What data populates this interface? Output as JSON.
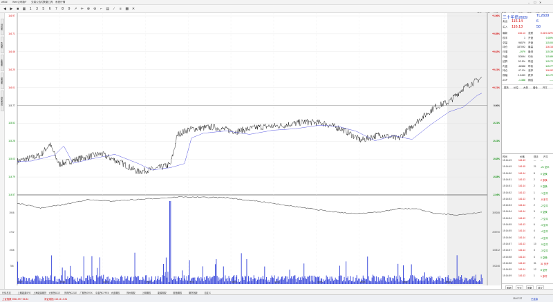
{
  "titlebar": {
    "app": "wMul",
    "items": [
      "Wen公司版F",
      "交易公告栏",
      "快捷工具",
      "系统行情"
    ]
  },
  "toolbar": {
    "icons": [
      "back-icon",
      "forward-icon",
      "square-icon",
      "grid-icon",
      "number-1-icon",
      "number-3-icon",
      "number-5-icon",
      "number-6-icon",
      "number-7-icon",
      "number-8-icon",
      "number-9-icon",
      "arrow-icon",
      "crosshair-icon",
      "zoom-in-icon",
      "zoom-out-icon",
      "bracket-icon",
      "chart-icon",
      "line-icon",
      "layers-icon",
      "grid2-icon",
      "close-icon"
    ],
    "right_tabs": [
      "成交",
      "分笔",
      "行情",
      "F10",
      "公告",
      "指标",
      "关联",
      "个股",
      "版块"
    ]
  },
  "left_tabs": [
    "分时图",
    "K线图",
    "走势图",
    "组合图",
    "综合资讯"
  ],
  "chart": {
    "price_left": [
      "116.97",
      "116.71",
      "116.46",
      "116.20",
      "116.01",
      "115.77",
      "115.52",
      "115.28",
      "115.03",
      "114.79",
      "114.57"
    ],
    "price_right": [
      "+1.06%",
      "+0.85%",
      "+0.62%",
      "+0.41%",
      "+0.21%",
      "0.00%",
      "-0.21%",
      "-0.41%",
      "-0.62%",
      "-0.83%",
      "-1.04%"
    ],
    "vol_left": [
      "3908",
      "2722",
      "1938",
      "786"
    ],
    "vol_right": [
      "309285",
      "205700",
      "103512",
      "192166"
    ],
    "x_ticks": [
      "07/27",
      "07/28",
      "07/29",
      "07/30",
      "07/31",
      "08/03",
      "08/04",
      "08/05",
      "08/06",
      "08/07",
      "08/10"
    ]
  },
  "quote": {
    "name": "三十年债2609",
    "code": "TL2609",
    "sell_label": "卖出",
    "sell_price": "116.14",
    "sell_qty": "6",
    "buy_label": "买入",
    "buy_price": "116.13",
    "buy_qty": "58",
    "rows": [
      {
        "l1": "最新",
        "v1": "116.14",
        "l2": "涨跌",
        "v2": "0.31/0.32%"
      },
      {
        "l1": "现手",
        "v1": "1",
        "l2": "开盘",
        "v2": "0.00%"
      },
      {
        "l1": "总量",
        "v1": "96579",
        "l2": "开盘",
        "v2": "115.00"
      },
      {
        "l1": "持仓",
        "v1": "187092",
        "l2": "最高",
        "v2": "116.16"
      },
      {
        "l1": "日增",
        "v1": "-1979",
        "l2": "最低",
        "v2": "115.39"
      },
      {
        "l1": "外盘",
        "v1": "52694",
        "l2": "均价",
        "v2": "115.89"
      },
      {
        "l1": "结算",
        "v1": "52.5%",
        "l2": "昨结",
        "v2": "115.72"
      },
      {
        "l1": "内盘",
        "v1": "46388",
        "l2": "昨收",
        "v2": "115.77"
      },
      {
        "l1": "持仓",
        "v1": "47.1%",
        "l2": "涨停",
        "v2": "116.92"
      },
      {
        "l1": "振幅",
        "v1": "2.0439",
        "l2": "跌停",
        "v2": "111.72"
      },
      {
        "l1": "ΔSP",
        "v1": "-1.388",
        "l2": "期结",
        "v2": "----"
      }
    ],
    "tabs": [
      "委托",
      "价位",
      "大单",
      "增仓",
      "开平"
    ]
  },
  "ticks": {
    "headers": [
      "时间",
      "价格",
      "现手",
      "开平"
    ],
    "rows": [
      {
        "t": "15:14:49",
        "p": "116.13",
        "q": "---",
        "o": "---"
      },
      {
        "t": "15:14:49",
        "p": "116.15",
        "q": "21",
        "o": "-21 空平"
      },
      {
        "t": "15:14:50",
        "p": "116.14",
        "q": "8",
        "o": "0 空换"
      },
      {
        "t": "15:14:51",
        "p": "116.13",
        "q": "2",
        "o": "2 多换"
      },
      {
        "t": "15:14:51",
        "p": "116.14",
        "q": "2",
        "o": "0 空换"
      },
      {
        "t": "15:14:52",
        "p": "116.13",
        "q": "1",
        "o": "-1 空平"
      },
      {
        "t": "15:14:53",
        "p": "116.13",
        "q": "9",
        "o": "-8 多平"
      },
      {
        "t": "15:14:53",
        "p": "116.14",
        "q": "2",
        "o": "-2 空平"
      },
      {
        "t": "15:14:54",
        "p": "116.14",
        "q": "3",
        "o": "0 空换"
      },
      {
        "t": "15:14:54",
        "p": "116.13",
        "q": "7",
        "o": "-7 空平"
      },
      {
        "t": "15:14:55",
        "p": "116.13",
        "q": "6",
        "o": "-3 空平"
      },
      {
        "t": "15:14:55",
        "p": "116.14",
        "q": "4",
        "o": "-4 空平"
      },
      {
        "t": "15:14:56",
        "p": "116.14",
        "q": "4",
        "o": "-4 空平"
      },
      {
        "t": "15:14:57",
        "p": "116.13",
        "q": "10",
        "o": "-9 空平"
      },
      {
        "t": "15:14:57",
        "p": "116.14",
        "q": "3",
        "o": "-3 空平"
      },
      {
        "t": "15:14:58",
        "p": "116.14",
        "q": "4",
        "o": "0 空换"
      },
      {
        "t": "15:14:58",
        "p": "116.13",
        "q": "31",
        "o": "31 多开"
      },
      {
        "t": "15:14:59",
        "p": "116.14",
        "q": "12",
        "o": "8 空开"
      },
      {
        "t": "15:14:59",
        "p": "116.13",
        "q": "1",
        "o": "1 多开"
      }
    ],
    "bottom_tabs": [
      "明细",
      "分价",
      "笔数",
      "成交"
    ]
  },
  "bottom_tabs": [
    "行情总览",
    "上期能源SFE",
    "上海能源期货",
    "大商所DCE",
    "郑商所CZCE",
    "广期所GFEX",
    "中金所CFFEX",
    "大连期权",
    "郑州期权",
    "上期期权",
    "能源期权",
    "股指期权",
    "期货指数",
    "自定义"
  ],
  "status": {
    "a": "上证指数 3964.59 +36.34",
    "b": "深证成指 115.16 -0.31",
    "time": "15:47:37",
    "conn": "已连接"
  },
  "colors": {
    "red": "#d40000",
    "green": "#008800",
    "price": "#222222",
    "avg": "#4a4adf",
    "vol": "#2b3bd8"
  }
}
